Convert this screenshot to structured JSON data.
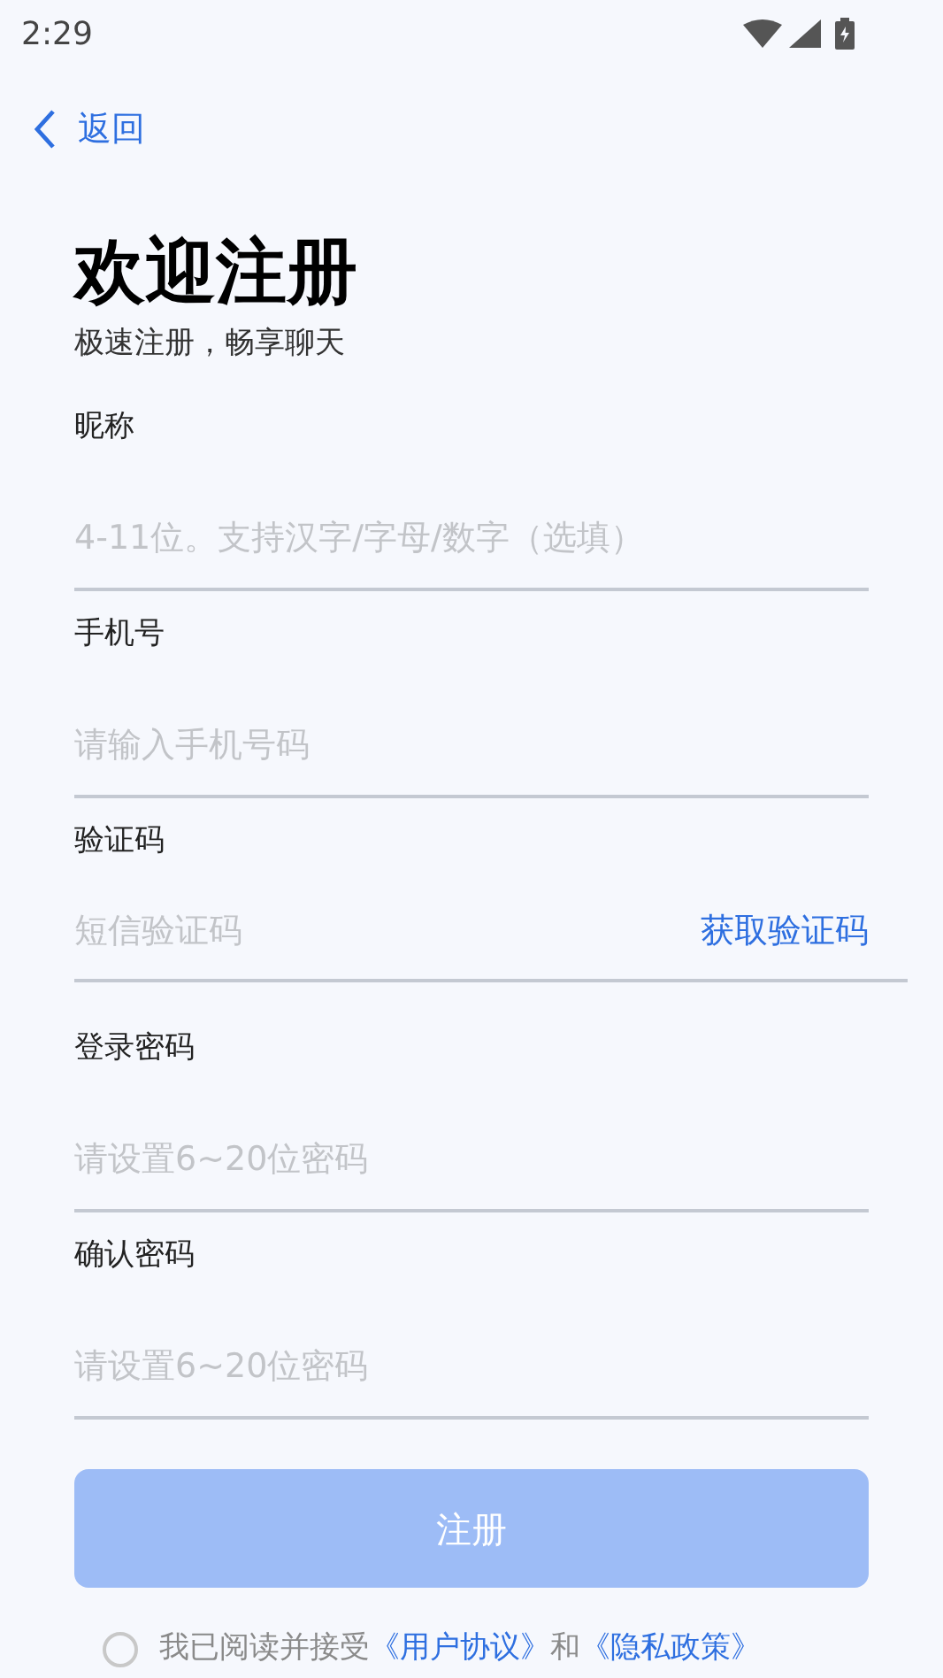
{
  "status_bar": {
    "time": "2:29"
  },
  "nav": {
    "back": "返回"
  },
  "title": "欢迎注册",
  "subtitle": "极速注册，畅享聊天",
  "fields": [
    {
      "kind": "text",
      "label": "昵称",
      "placeholder": "4-11位。支持汉字/字母/数字（选填）"
    },
    {
      "kind": "text",
      "label": "手机号",
      "placeholder": "请输入手机号码"
    },
    {
      "kind": "code",
      "label": "验证码",
      "placeholder": "短信验证码",
      "action": "获取验证码"
    },
    {
      "kind": "text",
      "label": "登录密码",
      "placeholder": "请设置6~20位密码"
    },
    {
      "kind": "text",
      "label": "确认密码",
      "placeholder": "请设置6~20位密码"
    }
  ],
  "submit": {
    "label": "注册",
    "disabled": true
  },
  "agreement": {
    "checked": false,
    "text": "我已阅读并接受",
    "link1": "《用户协议》",
    "and": "和",
    "link2": "《隐私政策》"
  }
}
